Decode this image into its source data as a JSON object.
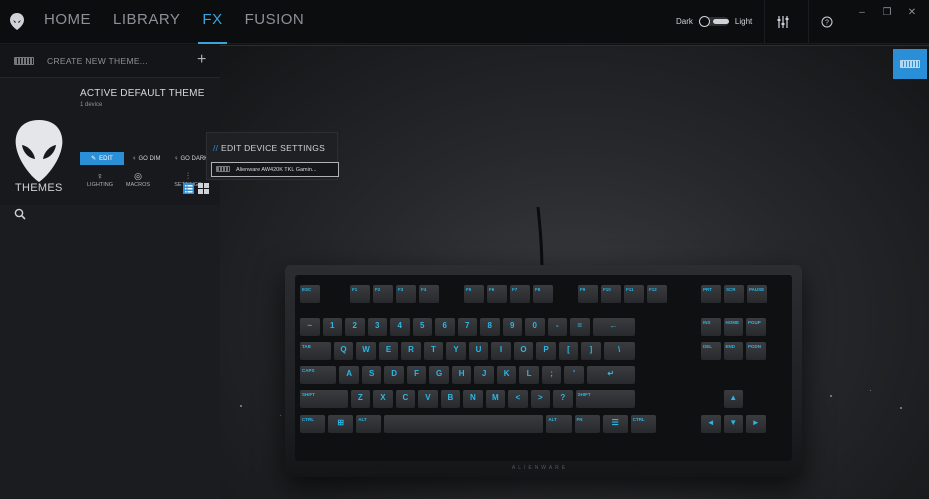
{
  "nav": {
    "items": [
      {
        "label": "HOME",
        "active": false
      },
      {
        "label": "LIBRARY",
        "active": false
      },
      {
        "label": "FX",
        "active": true
      },
      {
        "label": "FUSION",
        "active": false
      }
    ]
  },
  "topbar": {
    "dark_label": "Dark",
    "light_label": "Light",
    "mixer_icon": "sliders-icon",
    "help_icon": "help-circle-icon",
    "minimize": "–",
    "restore": "❐",
    "close": "✕"
  },
  "sidebar": {
    "create_label": "CREATE NEW THEME...",
    "add_symbol": "+",
    "active_title": "ACTIVE DEFAULT THEME",
    "active_sub": "1 device",
    "edit_label": "EDIT",
    "go_dim_label": "GO DIM",
    "go_dark_label": "GO DARK",
    "tools": [
      {
        "label": "LIGHTING",
        "icon": "bulb-icon",
        "glyph": "♀"
      },
      {
        "label": "MACROS",
        "icon": "macro-icon",
        "glyph": "◎"
      },
      {
        "label": "SETTINGS",
        "icon": "settings-sliders-icon",
        "glyph": "⫶"
      }
    ],
    "themes_heading": "THEMES"
  },
  "popup": {
    "title": "EDIT DEVICE SETTINGS",
    "slash": "//",
    "device_label": "Alienware AW420K TKL Gamin..."
  },
  "colors": {
    "accent": "#2a8fd6",
    "nav_active": "#3aa4dd",
    "key_legend": "#2ab7e6"
  },
  "keyboard": {
    "brand": "ALIENWARE",
    "rows": [
      [
        "ESC",
        "F1",
        "F2",
        "F3",
        "F4",
        "F5",
        "F6",
        "F7",
        "F8",
        "F9",
        "F10",
        "F11",
        "F12",
        "PRT",
        "SCR",
        "PAUSE"
      ],
      [
        "~",
        "1",
        "2",
        "3",
        "4",
        "5",
        "6",
        "7",
        "8",
        "9",
        "0",
        "-",
        "=",
        "←",
        "INS",
        "HOME",
        "PGUP"
      ],
      [
        "TAB",
        "Q",
        "W",
        "E",
        "R",
        "T",
        "Y",
        "U",
        "I",
        "O",
        "P",
        "[",
        "]",
        "\\",
        "DEL",
        "END",
        "PGDN"
      ],
      [
        "CAPS",
        "A",
        "S",
        "D",
        "F",
        "G",
        "H",
        "J",
        "K",
        "L",
        ";",
        "'",
        "↵"
      ],
      [
        "SHIFT",
        "Z",
        "X",
        "C",
        "V",
        "B",
        "N",
        "M",
        "<",
        ">",
        "?",
        "SHIFT",
        "▲"
      ],
      [
        "CTRL",
        "⊞",
        "ALT",
        "",
        "ALT",
        "FN",
        "☰",
        "CTRL",
        "◄",
        "▼",
        "►"
      ]
    ]
  }
}
